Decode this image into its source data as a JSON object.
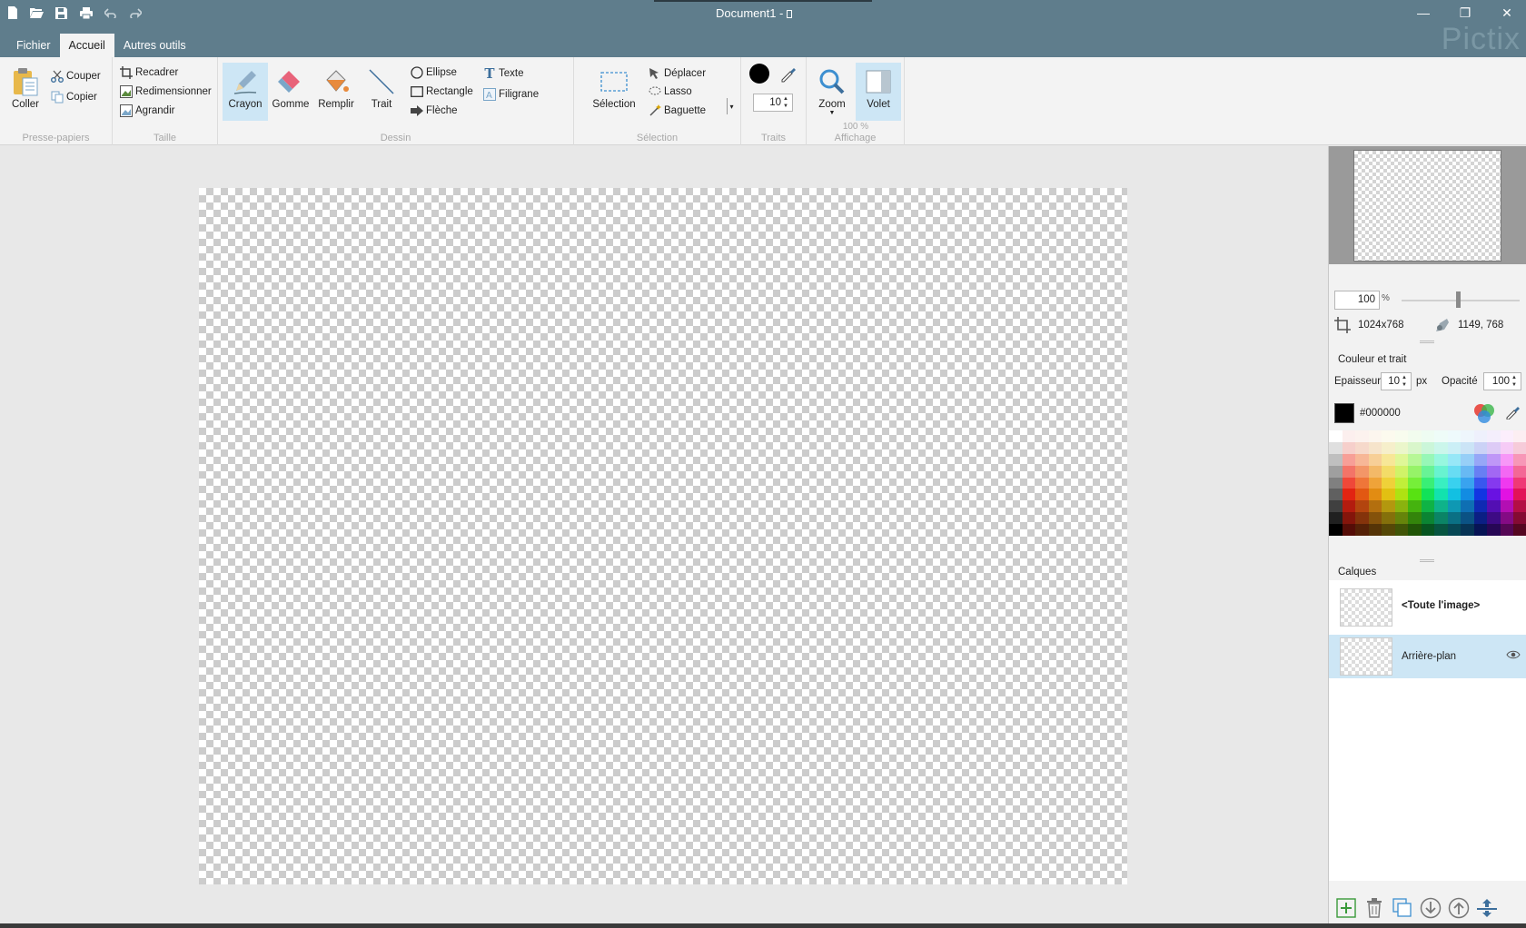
{
  "window": {
    "title": "Document1 - ",
    "brand": "Pictix",
    "minimize": "—",
    "restore": "❐",
    "close": "✕"
  },
  "quick_access": [
    "new-file-icon",
    "open-folder-icon",
    "save-icon",
    "print-icon",
    "undo-icon",
    "redo-icon"
  ],
  "tabs": [
    {
      "label": "Fichier",
      "active": false
    },
    {
      "label": "Accueil",
      "active": true
    },
    {
      "label": "Autres outils",
      "active": false
    }
  ],
  "ribbon": {
    "clipboard": {
      "group": "Presse-papiers",
      "paste": "Coller",
      "cut": "Couper",
      "copy": "Copier"
    },
    "size": {
      "group": "Taille",
      "crop": "Recadrer",
      "resize": "Redimensionner",
      "enlarge": "Agrandir"
    },
    "drawing": {
      "group": "Dessin",
      "pencil": "Crayon",
      "eraser": "Gomme",
      "fill": "Remplir",
      "line": "Trait",
      "ellipse": "Ellipse",
      "rectangle": "Rectangle",
      "arrow": "Flèche",
      "text": "Texte",
      "watermark": "Filigrane"
    },
    "selection": {
      "group": "Sélection",
      "select": "Sélection",
      "move": "Déplacer",
      "lasso": "Lasso",
      "wand": "Baguette"
    },
    "strokes": {
      "group": "Traits",
      "size": "10"
    },
    "display": {
      "group": "Affichage",
      "zoom": "Zoom",
      "zoom_value": "100 %",
      "panel": "Volet"
    }
  },
  "panel": {
    "zoom": {
      "value": "100",
      "unit": "%"
    },
    "image_size": "1024x768",
    "cursor_pos": "1149, 768",
    "color_section": "Couleur et trait",
    "thickness_label": "Epaisseur",
    "thickness_value": "10",
    "thickness_unit": "px",
    "opacity_label": "Opacité",
    "opacity_value": "100",
    "current_color": "#000000",
    "layers_section": "Calques",
    "layers": [
      {
        "name": "<Toute l'image>",
        "selected": false
      },
      {
        "name": "Arrière-plan",
        "selected": true
      }
    ]
  },
  "colors": {
    "titlebar": "#5f7d8c",
    "selected_tool": "#cde6f5",
    "selected_layer": "#cde6f5"
  }
}
